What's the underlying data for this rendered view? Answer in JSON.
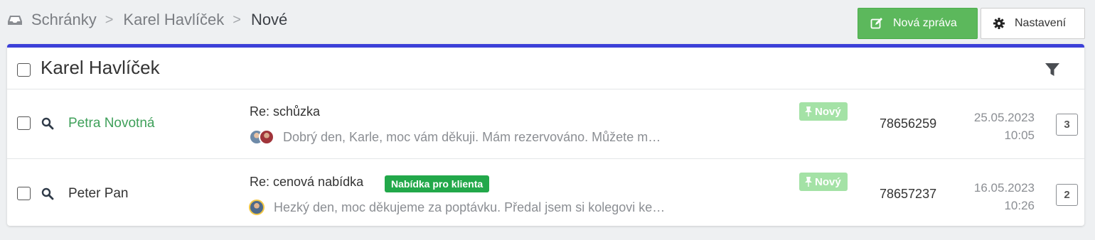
{
  "breadcrumb": {
    "icon": "inbox-icon",
    "items": [
      "Schránky",
      "Karel Havlíček"
    ],
    "separator": ">",
    "current": "Nové"
  },
  "toolbar": {
    "new_message_label": "Nová zpráva",
    "new_message_icon": "edit-icon",
    "settings_label": "Nastavení",
    "settings_icon": "gear-icon"
  },
  "panel": {
    "title": "Karel Havlíček",
    "accent_color": "#3c40d8",
    "filter_icon": "filter-icon"
  },
  "messages": [
    {
      "sender": "Petra Novotná",
      "sender_color": "#3fa05a",
      "subject": "Re: schůzka",
      "badge": "",
      "preview": "Dobrý den, Karle,  moc vám děkuji.  Mám rezervováno. Můžete m…",
      "status": "Nový",
      "id": "78656259",
      "date": "25.05.2023",
      "time": "10:05",
      "count": "3"
    },
    {
      "sender": "Peter Pan",
      "sender_color": "#333333",
      "subject": "Re: cenová nabídka",
      "badge": "Nabídka pro klienta",
      "preview": "Hezký den,  moc děkujeme za poptávku. Předal jsem si kolegovi ke…",
      "status": "Nový",
      "id": "78657237",
      "date": "16.05.2023",
      "time": "10:26",
      "count": "2"
    }
  ]
}
